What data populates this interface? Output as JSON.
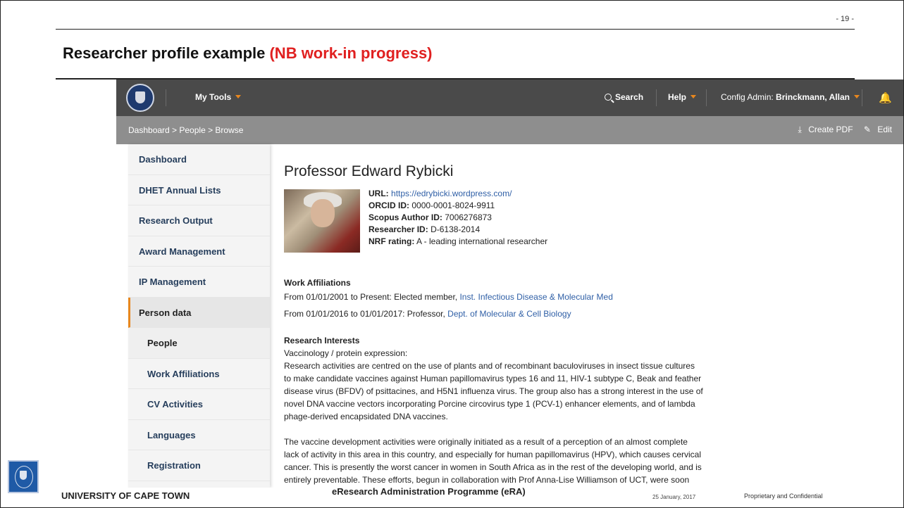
{
  "slide": {
    "page_number": "- 19 -",
    "title_main": "Researcher profile example ",
    "title_nb": "(NB work-in progress)"
  },
  "topbar": {
    "logo_icon": "uct-crest-icon",
    "my_tools": "My Tools",
    "search": "Search",
    "help": "Help",
    "config_admin_prefix": "Config Admin: ",
    "config_admin_name": "Brinckmann, Allan",
    "notification_icon": "bell-icon",
    "caret_color": "#e8871e"
  },
  "subbar": {
    "breadcrumb": "Dashboard > People > Browse",
    "create_pdf": "Create PDF",
    "edit": "Edit"
  },
  "sidebar": {
    "items": [
      {
        "label": "Dashboard"
      },
      {
        "label": "DHET Annual Lists"
      },
      {
        "label": "Research Output"
      },
      {
        "label": "Award Management"
      },
      {
        "label": "IP Management"
      },
      {
        "label": "Person data"
      },
      {
        "label": "People"
      },
      {
        "label": "Work Affiliations"
      },
      {
        "label": "CV Activities"
      },
      {
        "label": "Languages"
      },
      {
        "label": "Registration"
      }
    ]
  },
  "profile": {
    "name": "Professor Edward Rybicki",
    "url_label": "URL:",
    "url_value": "https://edrybicki.wordpress.com/",
    "orcid_label": "ORCID ID:",
    "orcid_value": "0000-0001-8024-9911",
    "scopus_label": "Scopus Author ID:",
    "scopus_value": "7006276873",
    "researcher_label": "Researcher ID:",
    "researcher_value": "D-6138-2014",
    "nrf_label": "NRF rating:",
    "nrf_value": "A - leading international researcher"
  },
  "work_affiliations": {
    "heading": "Work Affiliations",
    "items": [
      {
        "text": "From 01/01/2001 to Present: Elected member, ",
        "link": "Inst. Infectious Disease & Molecular Med"
      },
      {
        "text": "From 01/01/2016 to 01/01/2017: Professor, ",
        "link": "Dept. of Molecular & Cell Biology"
      }
    ]
  },
  "research_interests": {
    "heading": "Research Interests",
    "subheading": "Vaccinology / protein expression:",
    "lines": [
      "Research activities are centred on the use of plants and of recombinant baculoviruses in insect tissue cultures",
      "to make candidate vaccines against Human papillomavirus types 16 and 11, HIV-1 subtype C, Beak and feather",
      "disease virus (BFDV) of psittacines, and H5N1 influenza virus. The group also has a strong interest in the use of",
      "novel DNA vaccine vectors incorporating Porcine circovirus type 1 (PCV-1) enhancer elements, and of lambda",
      "phage-derived encapsidated DNA vaccines."
    ],
    "lines2": [
      "The vaccine development activities were originally initiated as a result of a perception of an almost complete",
      "lack of activity in this area in this country, and especially for human papillomavirus (HPV), which causes cervical",
      "cancer. This is presently the worst cancer in women in South Africa as in the rest of the developing world, and is",
      "entirely preventable. These efforts, begun in collaboration with Prof Anna-Lise Williamson of UCT, were soon"
    ]
  },
  "footer": {
    "university": "UNIVERSITY OF CAPE TOWN",
    "programme": "eResearch Administration Programme (eRA)",
    "date": "25 January, 2017",
    "confidential": "Proprietary and Confidential"
  }
}
